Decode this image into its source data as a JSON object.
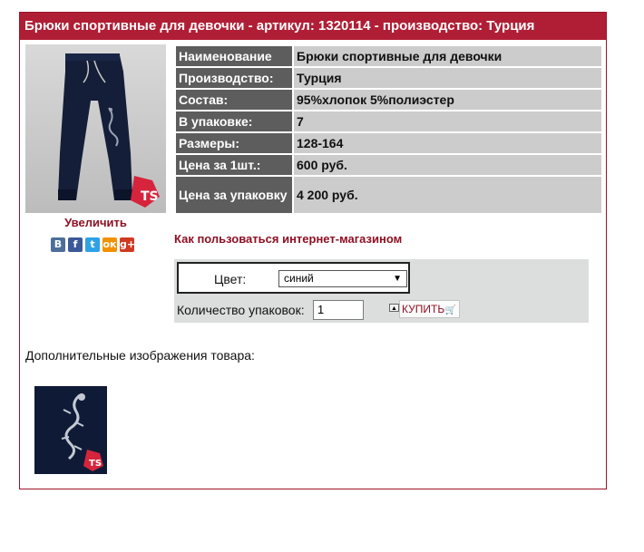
{
  "title": "Брюки спортивные для девочки - артикул: 1320114 - производство: Турция",
  "enlarge_link": "Увеличить",
  "social": [
    {
      "icon": "vk-icon",
      "glyph": "В",
      "color": "#4c6e99"
    },
    {
      "icon": "facebook-icon",
      "glyph": "f",
      "color": "#3b5998"
    },
    {
      "icon": "twitter-icon",
      "glyph": "t",
      "color": "#2ea2e6"
    },
    {
      "icon": "odnoklassniki-icon",
      "glyph": "ок",
      "color": "#f29100"
    },
    {
      "icon": "google-plus-icon",
      "glyph": "g+",
      "color": "#cf3b22"
    }
  ],
  "specs": [
    {
      "label": "Наименование",
      "value": "Брюки спортивные для девочки"
    },
    {
      "label": "Производство:",
      "value": "Турция"
    },
    {
      "label": "Состав:",
      "value": "95%хлопок 5%полиэстер"
    },
    {
      "label": "В упаковке:",
      "value": "7"
    },
    {
      "label": "Размеры:",
      "value": "128-164"
    },
    {
      "label": "Цена за 1шт.:",
      "value": "600 руб."
    },
    {
      "label": "Цена за упаковку",
      "value": "4 200 руб."
    }
  ],
  "howto_link": "Как пользоваться интернет-магазином",
  "order": {
    "color_label": "Цвет:",
    "color_selected": "синий",
    "qty_label": "Количество упаковок:",
    "qty_value": "1",
    "buy_label": "КУПИТЬ"
  },
  "extra_images_label": "Дополнительные изображения товара:",
  "colors": {
    "accent": "#b01e35",
    "link": "#8e1023",
    "spec_key_bg": "#5d5d5d",
    "spec_val_bg": "#cccccc"
  }
}
